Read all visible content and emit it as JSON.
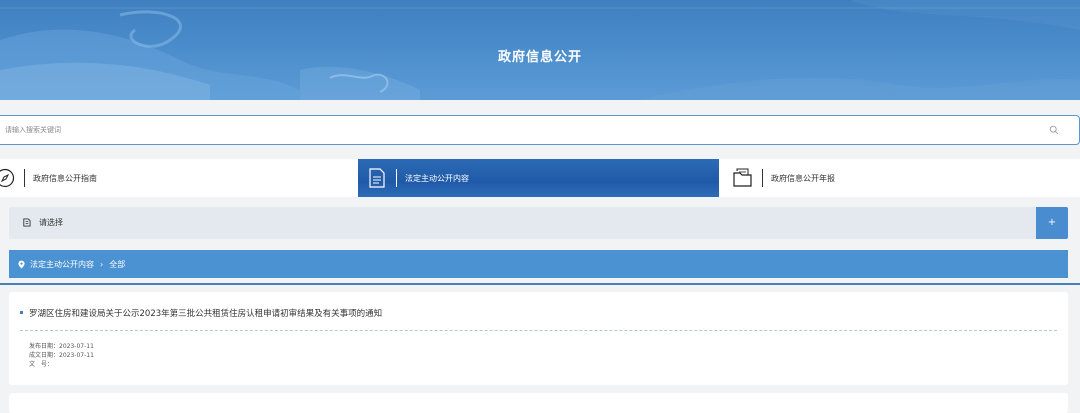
{
  "banner": {
    "title": "政府信息公开"
  },
  "search": {
    "placeholder": "请输入搜索关键词"
  },
  "tabs": [
    {
      "label": "政府信息公开指南",
      "icon": "compass-icon",
      "active": false
    },
    {
      "label": "法定主动公开内容",
      "icon": "document-icon",
      "active": true
    },
    {
      "label": "政府信息公开年报",
      "icon": "folder-icon",
      "active": false
    }
  ],
  "select_bar": {
    "label": "请选择",
    "plus": "+"
  },
  "breadcrumb": {
    "root": "法定主动公开内容",
    "separator": "›",
    "current": "全部"
  },
  "articles": [
    {
      "title": "罗湖区住房和建设局关于公示2023年第三批公共租赁住房认租申请初审结果及有关事项的通知",
      "publish_label": "发布日期：",
      "publish_date": "2023-07-11",
      "written_label": "成文日期：",
      "written_date": "2023-07-11",
      "doc_no_label": "文　号：",
      "doc_no": ""
    }
  ],
  "colors": {
    "accent": "#4a92d1",
    "active_tab": "#1f5aa8",
    "banner": "#4a8ccb"
  }
}
